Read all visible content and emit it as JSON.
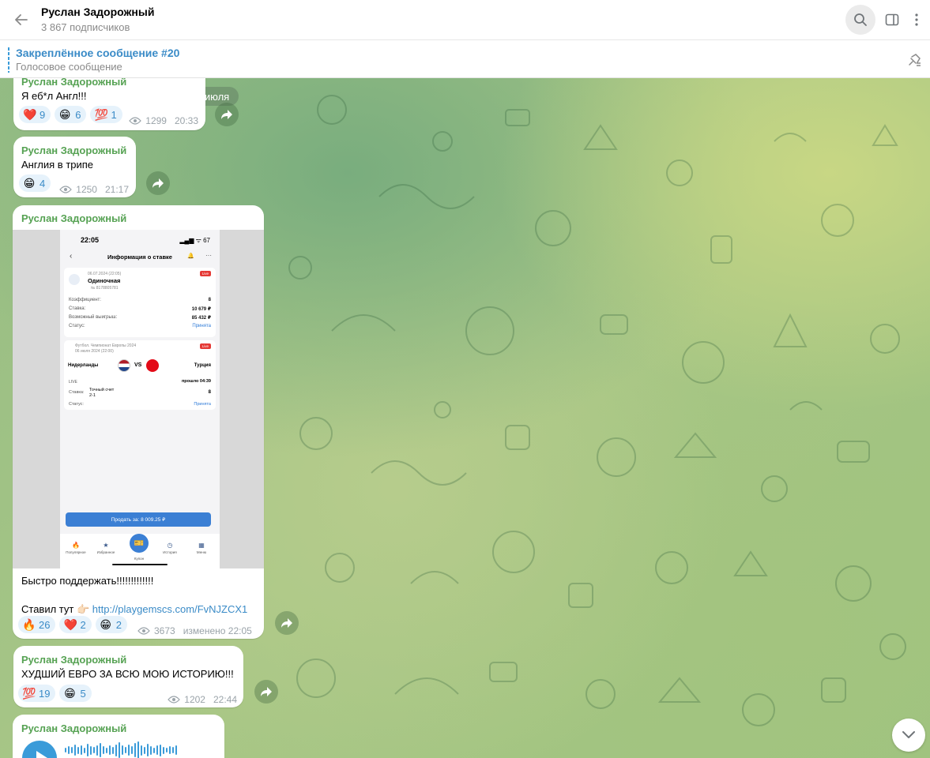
{
  "header": {
    "title": "Руслан Задорожный",
    "subscribers": "3 867 подписчиков",
    "icons": [
      "back-arrow-icon",
      "search-icon",
      "sidebar-toggle-icon",
      "more-vertical-icon"
    ]
  },
  "pinned": {
    "title": "Закреплённое сообщение #20",
    "subtitle": "Голосовое сообщение"
  },
  "date_separator": "6 июля",
  "messages": [
    {
      "author": "Руслан Задорожный",
      "text": "Я еб*л Англ!!!",
      "reactions": [
        {
          "emoji": "❤️",
          "count": "9"
        },
        {
          "emoji": "😁",
          "count": "6"
        },
        {
          "emoji": "💯",
          "count": "1"
        }
      ],
      "views": "1299",
      "time": "20:33"
    },
    {
      "author": "Руслан Задорожный",
      "text": "Англия в трипе",
      "reactions": [
        {
          "emoji": "😁",
          "count": "4"
        }
      ],
      "views": "1250",
      "time": "21:17"
    },
    {
      "author": "Руслан Задорожный",
      "screenshot": {
        "time": "22:05",
        "status": "▂▄▆ ᯤ 67",
        "nav_title": "Информация о ставке",
        "bet_date": "06.07.2024 (22:05)",
        "bet_type": "Одиночная",
        "bet_id": "№ 8178805781",
        "live_badge": "Live",
        "rows": [
          {
            "k": "Коэффициент:",
            "v": "8"
          },
          {
            "k": "Ставка:",
            "v": "10 679 ₽"
          },
          {
            "k": "Возможный выигрыш:",
            "v": "85 432 ₽"
          },
          {
            "k": "Статус:",
            "v": "Принята"
          }
        ],
        "league": "Футбол. Чемпионат Европы 2024",
        "match_date": "06 июля 2024 (22:00)",
        "team1": "Нидерланды",
        "vs": "VS",
        "team2": "Турция",
        "live_label": "LIVE",
        "elapsed": "прошло 04:39",
        "outcome_k": "Ставка:",
        "outcome_name": "Точный счет",
        "outcome_val": "2-1",
        "outcome_coef": "8",
        "status_k": "Статус:",
        "status_v": "Принята",
        "sell_button": "Продать за: 8 009.25 ₽",
        "tabs": [
          "Популярное",
          "Избранное",
          "Купон",
          "История",
          "Меню"
        ]
      },
      "text1": "Быстро поддержать!!!!!!!!!!!!!",
      "text2_prefix": "Ставил тут 👉🏻 ",
      "link": "http://playgemscs.com/FvNJZCX1",
      "reactions": [
        {
          "emoji": "🔥",
          "count": "26"
        },
        {
          "emoji": "❤️",
          "count": "2"
        },
        {
          "emoji": "😁",
          "count": "2"
        }
      ],
      "views": "3673",
      "time": "изменено 22:05"
    },
    {
      "author": "Руслан Задорожный",
      "text": "ХУДШИЙ ЕВРО ЗА ВСЮ МОЮ ИСТОРИЮ!!!",
      "reactions": [
        {
          "emoji": "💯",
          "count": "19"
        },
        {
          "emoji": "😁",
          "count": "5"
        }
      ],
      "views": "1202",
      "time": "22:44"
    },
    {
      "author": "Руслан Задорожный",
      "type": "voice"
    }
  ],
  "colors": {
    "accent": "#3a9bd9",
    "author": "#56a253",
    "reaction_bg": "#e6f2fb"
  }
}
